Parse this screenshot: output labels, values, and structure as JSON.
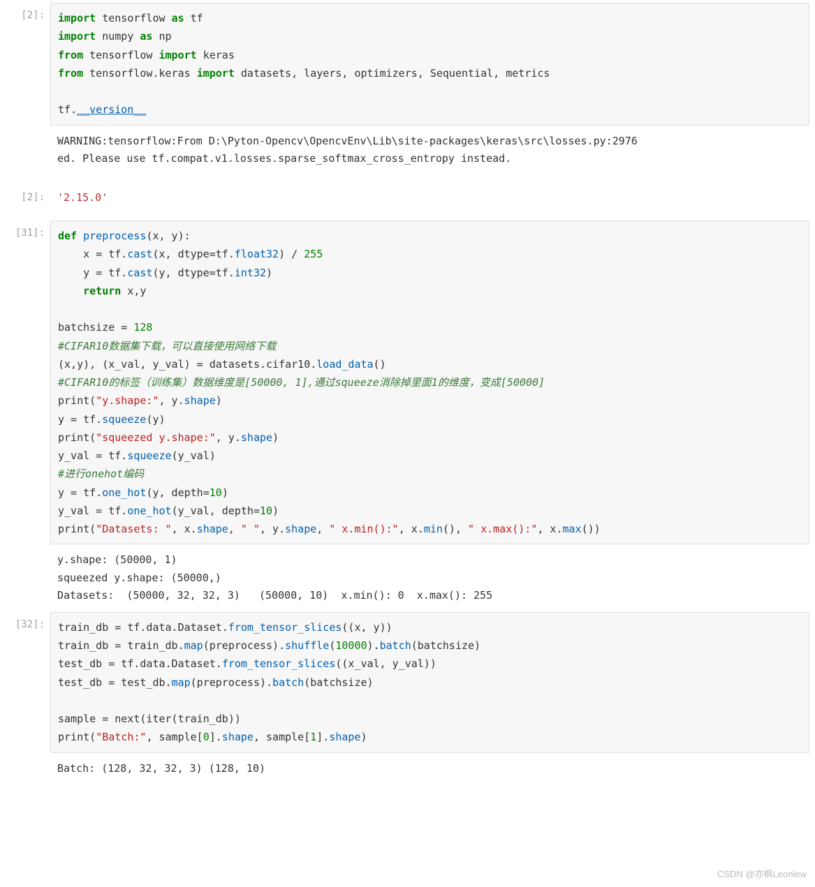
{
  "cells": {
    "c1": {
      "prompt": "[2]:",
      "html": "<span class='kw'>import</span> tensorflow <span class='kw'>as</span> tf\n<span class='kw'>import</span> numpy <span class='kw'>as</span> np\n<span class='kw'>from</span> tensorflow <span class='kw'>import</span> keras\n<span class='kw'>from</span> tensorflow.keras <span class='kw'>import</span> datasets, layers, optimizers, Sequential, metrics\n\ntf.<span class='magic'>__version__</span>"
    },
    "o1": {
      "prompt": "",
      "text": "WARNING:tensorflow:From D:\\Pyton-Opencv\\OpencvEnv\\Lib\\site-packages\\keras\\src\\losses.py:2976\ned. Please use tf.compat.v1.losses.sparse_softmax_cross_entropy instead."
    },
    "o1b": {
      "prompt": "[2]:",
      "html": "<span class='outstr'>'2.15.0'</span>"
    },
    "c2": {
      "prompt": "[31]:",
      "html": "<span class='kw'>def</span> <span class='fn'>preprocess</span>(x, y):\n    x = tf.<span class='fn'>cast</span>(x, dtype=tf.<span class='fn'>float32</span>) / <span class='num'>255</span>\n    y = tf.<span class='fn'>cast</span>(y, dtype=tf.<span class='fn'>int32</span>)\n    <span class='kw'>return</span> x,y\n\nbatchsize = <span class='num'>128</span>\n<span class='cmt'>#CIFAR10数据集下载，可以直接使用网络下载</span>\n(x,y), (x_val, y_val) = datasets.cifar10.<span class='fn'>load_data</span>()\n<span class='cmt'>#CIFAR10的标签（训练集）数据维度是[50000, 1],通过squeeze消除掉里面1的维度，变成[50000]</span>\nprint(<span class='str'>\"y.shape:\"</span>, y.<span class='fn'>shape</span>)\ny = tf.<span class='fn'>squeeze</span>(y)\nprint(<span class='str'>\"squeezed y.shape:\"</span>, y.<span class='fn'>shape</span>)\ny_val = tf.<span class='fn'>squeeze</span>(y_val)\n<span class='cmt'>#进行onehot编码</span>\ny = tf.<span class='fn'>one_hot</span>(y, depth=<span class='num'>10</span>)\ny_val = tf.<span class='fn'>one_hot</span>(y_val, depth=<span class='num'>10</span>)\nprint(<span class='str'>\"Datasets: \"</span>, x.<span class='fn'>shape</span>, <span class='str'>\" \"</span>, y.<span class='fn'>shape</span>, <span class='str'>\" x.min():\"</span>, x.<span class='fn'>min</span>(), <span class='str'>\" x.max():\"</span>, x.<span class='fn'>max</span>())"
    },
    "o2": {
      "prompt": "",
      "text": "y.shape: (50000, 1)\nsqueezed y.shape: (50000,)\nDatasets:  (50000, 32, 32, 3)   (50000, 10)  x.min(): 0  x.max(): 255"
    },
    "c3": {
      "prompt": "[32]:",
      "html": "train_db = tf.data.Dataset.<span class='fn'>from_tensor_slices</span>((x, y))\ntrain_db = train_db.<span class='fn'>map</span>(preprocess).<span class='fn'>shuffle</span>(<span class='num'>10000</span>).<span class='fn'>batch</span>(batchsize)\ntest_db = tf.data.Dataset.<span class='fn'>from_tensor_slices</span>((x_val, y_val))\ntest_db = test_db.<span class='fn'>map</span>(preprocess).<span class='fn'>batch</span>(batchsize)\n\nsample = next(iter(train_db))\nprint(<span class='str'>\"Batch:\"</span>, sample[<span class='num'>0</span>].<span class='fn'>shape</span>, sample[<span class='num'>1</span>].<span class='fn'>shape</span>)"
    },
    "o3": {
      "prompt": "",
      "text": "Batch: (128, 32, 32, 3) (128, 10)"
    }
  },
  "watermark": "CSDN @亦枫Leonlew"
}
